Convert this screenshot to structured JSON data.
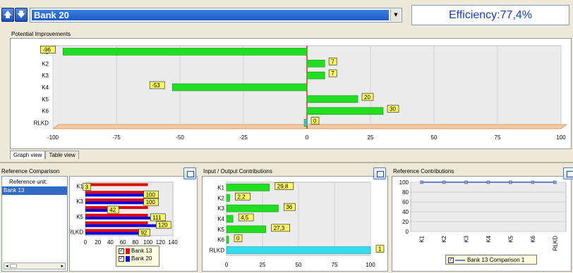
{
  "toolbar": {
    "up_glyph": "🡅",
    "down_glyph": "🡇",
    "unit_select": "Bank 20",
    "efficiency": "Efficiency:77,4%"
  },
  "potential": {
    "title": "Potential Improvements",
    "tabs": [
      "Graph view",
      "Table view"
    ]
  },
  "refcomp": {
    "title": "Reference Comparison",
    "unit_label": "Reference unit:",
    "units": [
      "Bank 13"
    ]
  },
  "io": {
    "title": "Input / Output Contributions"
  },
  "refcontrib": {
    "title": "Reference Contributions"
  },
  "chart_data": [
    {
      "type": "bar",
      "name": "potential",
      "categories": [
        "K1",
        "K2",
        "K3",
        "K4",
        "K5",
        "K6",
        "RLKD"
      ],
      "values": [
        -96,
        7,
        7,
        -53,
        20,
        30,
        0
      ],
      "xlim": [
        -100,
        100
      ],
      "xticks": [
        "-100",
        "-75",
        "-50",
        "-25",
        "0",
        "25",
        "50",
        "75",
        "100"
      ]
    },
    {
      "type": "bar",
      "name": "reference-comparison",
      "categories": [
        "K1",
        "K2",
        "K3",
        "K4",
        "K5",
        "K6",
        "RLKD"
      ],
      "category_labels": [
        "K1",
        "",
        "K3",
        "",
        "K5",
        "",
        "RLKD"
      ],
      "series": [
        {
          "name": "Bank 13",
          "values": [
            100,
            100,
            100,
            100,
            100,
            100,
            100
          ]
        },
        {
          "name": "Bank 20",
          "values": [
            3,
            100,
            100,
            42,
            111,
            120,
            92
          ]
        }
      ],
      "value_labels": [
        "3",
        "100",
        "100",
        "42",
        "111",
        "120",
        "92"
      ],
      "xlim": [
        0,
        140
      ],
      "xticks": [
        "0",
        "20",
        "40",
        "60",
        "80",
        "100",
        "120",
        "140"
      ],
      "legend": [
        "Bank 13",
        "Bank 20"
      ],
      "legend_colors": [
        "#e00000",
        "#0000e0"
      ]
    },
    {
      "type": "bar",
      "name": "io-contributions",
      "categories": [
        "K1",
        "K2",
        "K3",
        "K4",
        "K5",
        "K6",
        "RLKD"
      ],
      "values": [
        29.8,
        2.2,
        36,
        4.5,
        27.3,
        0,
        100
      ],
      "value_labels": [
        "29,8",
        "2,2",
        "36",
        "4,5",
        "27,3",
        "0",
        "1"
      ],
      "xlim": [
        0,
        100
      ],
      "xticks": [
        "0",
        "25",
        "50",
        "75",
        "100"
      ]
    },
    {
      "type": "line",
      "name": "reference-contributions",
      "categories": [
        "K1",
        "K2",
        "K3",
        "K4",
        "K5",
        "K6",
        "RLKD"
      ],
      "series": [
        {
          "name": "Bank 13 Comparison 1",
          "values": [
            100,
            100,
            100,
            100,
            100,
            100,
            100
          ]
        }
      ],
      "ylim": [
        0,
        100
      ],
      "yticks": [
        "0",
        "20",
        "40",
        "60",
        "80",
        "100"
      ]
    }
  ]
}
